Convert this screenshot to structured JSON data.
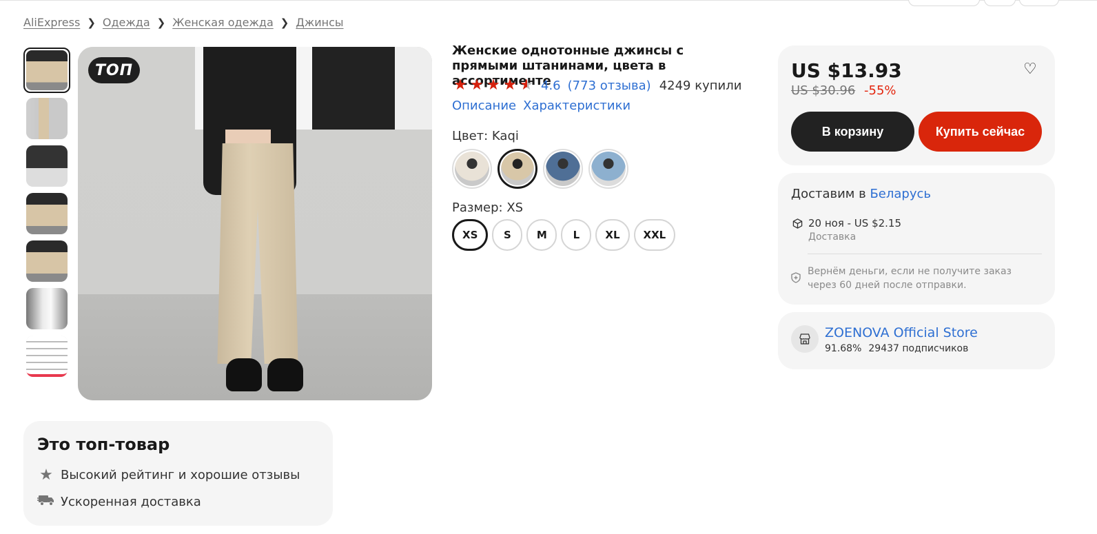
{
  "breadcrumb": [
    "AliExpress",
    "Одежда",
    "Женская одежда",
    "Джинсы"
  ],
  "product": {
    "badge": "ТОП",
    "title": "Женские однотонные джинсы с прямыми штанинами, цвета в ассортименте",
    "rating_value": "4.6",
    "rating_stars": 4.6,
    "reviews": "(773 отзыва)",
    "sold": "4249 купили",
    "tabs": [
      "Описание",
      "Характеристики"
    ],
    "color_label": "Цвет: Kaqi",
    "size_label": "Размер: XS",
    "sizes": [
      "XS",
      "S",
      "M",
      "L",
      "XL",
      "XXL"
    ],
    "selected_size": "XS",
    "color_count": 4,
    "selected_color_index": 1
  },
  "buybox": {
    "price": "US $13.93",
    "old_price": "US $30.96",
    "discount": "-55%",
    "cart_label": "В корзину",
    "buy_label": "Купить сейчас",
    "accent": "#d9260b"
  },
  "delivery": {
    "prefix": "Доставим в",
    "country": "Беларусь",
    "date_price": "20 ноя - US $2.15",
    "type": "Доставка",
    "guarantee": "Вернём деньги, если не получите заказ через 60 дней после отправки."
  },
  "store": {
    "name": "ZOENOVA Official Store",
    "rating": "91.68%",
    "followers": "29437 подписчиков"
  },
  "top_product": {
    "title": "Это топ-товар",
    "features": [
      "Высокий рейтинг и хорошие отзывы",
      "Ускоренная доставка"
    ]
  }
}
